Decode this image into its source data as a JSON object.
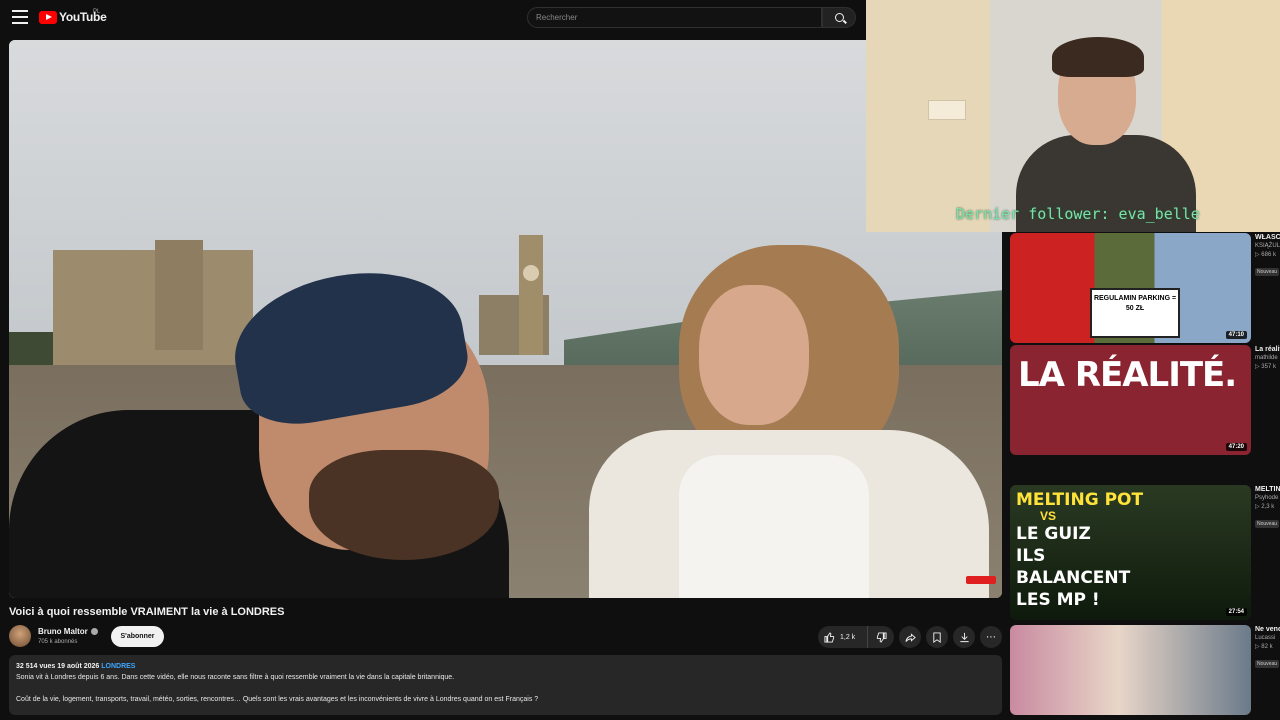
{
  "header": {
    "logo_text": "YouTube",
    "logo_country": "PL",
    "search_placeholder": "Rechercher"
  },
  "overlay": {
    "follower_text": "Dernier follower: eva_belle"
  },
  "video": {
    "title": "Voici à quoi ressemble VRAIMENT la vie à LONDRES",
    "channel_name": "Bruno Maltor",
    "subscribers": "705 k abonnés",
    "subscribe_label": "S'abonner",
    "likes": "1,2 k",
    "views": "32 514 vues",
    "date": "19 août 2026",
    "tag": "LONDRES",
    "description_line1": "Sonia vit à Londres depuis 6 ans. Dans cette vidéo, elle nous raconte sans filtre à quoi ressemble vraiment la vie dans la capitale britannique.",
    "description_line2": "Coût de la vie, logement, transports, travail, météo, sorties, rencontres… Quels sont les vrais avantages et les inconvénients de vivre à Londres quand on est Français ?"
  },
  "recommendations": [
    {
      "title": "WŁASC",
      "channel": "KSIĄŻUL",
      "views": "▷ 686 k",
      "badge": "Nouveau",
      "duration": "47:10",
      "thumb_text": "REGULAMIN PARKING = 50 ZŁ"
    },
    {
      "title": "La réalit améric",
      "channel": "mathilde",
      "views": "▷ 357 k",
      "badge": "",
      "duration": "47:20",
      "thumb_text": "LA RÉALITÉ."
    },
    {
      "title": "MELTIN TOURN !",
      "channel": "Psyhode",
      "views": "▷ 2,3 k",
      "badge": "Nouveau",
      "duration": "27:54",
      "thumb_line1": "MELTING POT",
      "thumb_line2": "VS",
      "thumb_line3": "LE GUIZ ILS BALANCENT LES MP !"
    },
    {
      "title": "Ne venc pour y v",
      "channel": "Lucassi",
      "views": "▷ 82 k",
      "badge": "Nouveau",
      "duration": "",
      "thumb_text": ""
    }
  ]
}
